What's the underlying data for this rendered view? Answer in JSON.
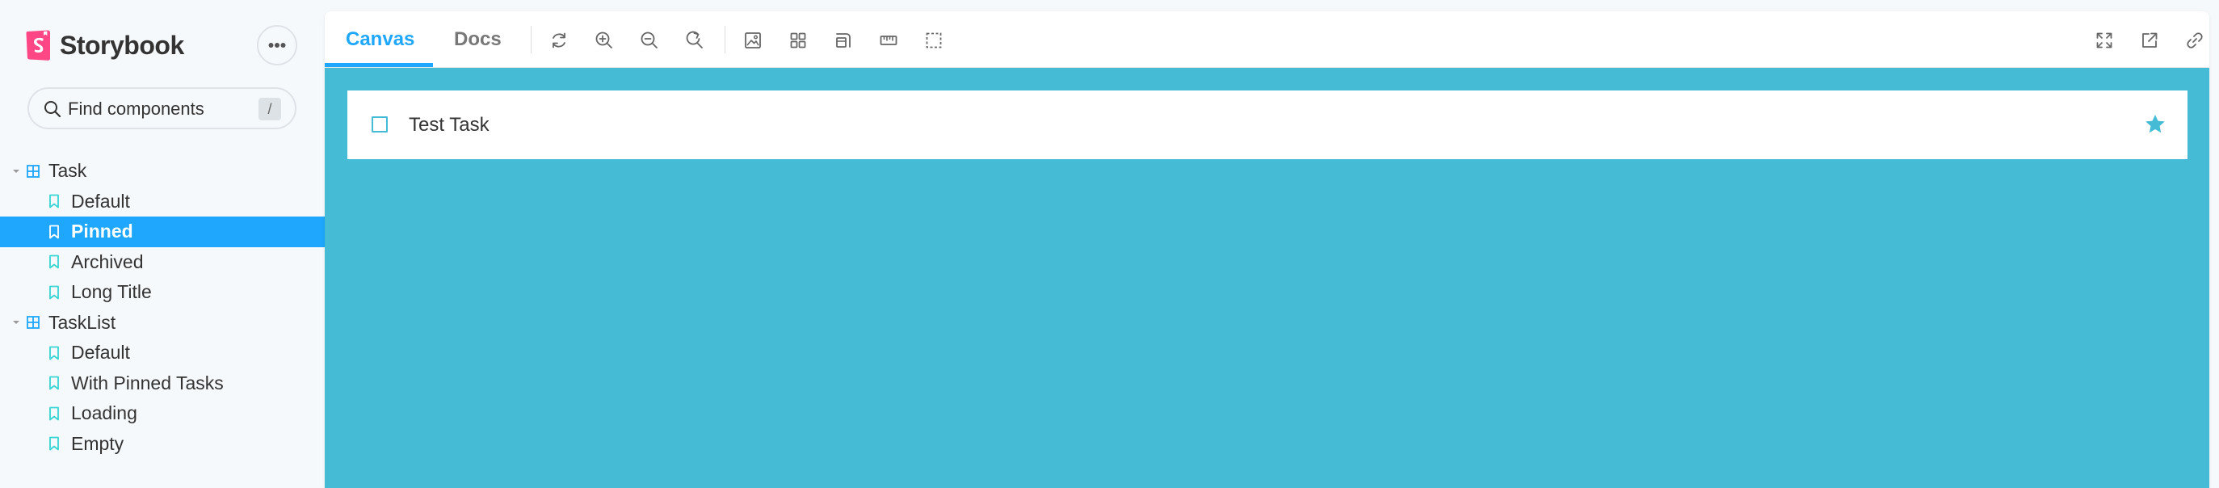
{
  "brand": {
    "name": "Storybook"
  },
  "search": {
    "placeholder": "Find components",
    "shortcut": "/"
  },
  "sidebar": {
    "tree": [
      {
        "kind": "component",
        "label": "Task"
      },
      {
        "kind": "story",
        "label": "Default"
      },
      {
        "kind": "story",
        "label": "Pinned",
        "selected": true
      },
      {
        "kind": "story",
        "label": "Archived"
      },
      {
        "kind": "story",
        "label": "Long Title"
      },
      {
        "kind": "component",
        "label": "TaskList"
      },
      {
        "kind": "story",
        "label": "Default"
      },
      {
        "kind": "story",
        "label": "With Pinned Tasks"
      },
      {
        "kind": "story",
        "label": "Loading"
      },
      {
        "kind": "story",
        "label": "Empty"
      }
    ]
  },
  "toolbar": {
    "tabs": [
      {
        "label": "Canvas",
        "active": true
      },
      {
        "label": "Docs",
        "active": false
      }
    ],
    "tools": [
      "reload-icon",
      "zoom-in-icon",
      "zoom-out-icon",
      "zoom-reset-icon",
      "background-icon",
      "grid-icon",
      "viewport-icon",
      "measure-icon",
      "outline-icon"
    ],
    "right_tools": [
      "fullscreen-icon",
      "open-new-tab-icon",
      "copy-link-icon"
    ]
  },
  "preview": {
    "background": "#45bbd5",
    "task": {
      "title": "Test Task",
      "checked": false,
      "pinned": true
    }
  },
  "colors": {
    "accent": "#1ea7fd",
    "brand": "#ff4785",
    "story_icon": "#37d5d3",
    "component_icon": "#1ea7fd",
    "task_accent": "#45bbd5"
  }
}
